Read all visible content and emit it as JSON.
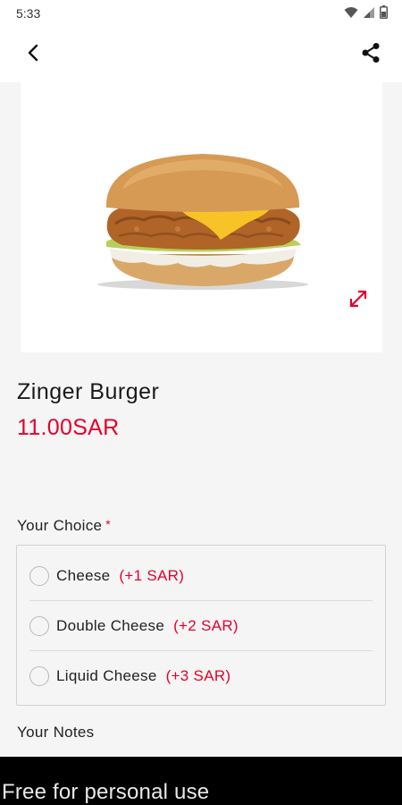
{
  "status_bar": {
    "time": "5:33",
    "icons": [
      "wifi-icon",
      "signal-icon",
      "battery-icon"
    ]
  },
  "app_bar": {
    "back_icon": "chevron-left-icon",
    "share_icon": "share-icon"
  },
  "product": {
    "name": "Zinger Burger",
    "price": "11.00SAR",
    "image_icon": "burger-image",
    "expand_icon": "expand-icon"
  },
  "choice": {
    "title": "Your Choice",
    "required_marker": "*",
    "options": [
      {
        "label": "Cheese",
        "price": "(+1 SAR)",
        "selected": false
      },
      {
        "label": "Double Cheese",
        "price": "(+2 SAR)",
        "selected": false
      },
      {
        "label": "Liquid Cheese",
        "price": "(+3 SAR)",
        "selected": false
      }
    ]
  },
  "notes": {
    "title": "Your Notes"
  },
  "banner": {
    "text": "Free for personal use"
  },
  "colors": {
    "accent": "#e4002b",
    "background": "#f5f5f5",
    "card": "#ffffff",
    "banner": "#000000"
  }
}
